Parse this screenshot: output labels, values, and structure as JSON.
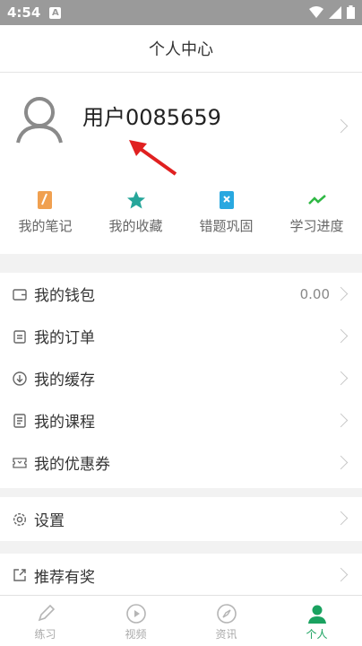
{
  "status_bar": {
    "time": "4:54",
    "notification_letter": "A"
  },
  "header": {
    "title": "个人中心"
  },
  "profile": {
    "username": "用户0085659"
  },
  "quick_actions": [
    {
      "label": "我的笔记",
      "icon": "note-icon",
      "color": "#f0a050"
    },
    {
      "label": "我的收藏",
      "icon": "star-icon",
      "color": "#26a69a"
    },
    {
      "label": "错题巩固",
      "icon": "wrong-question-icon",
      "color": "#29a8e0"
    },
    {
      "label": "学习进度",
      "icon": "progress-icon",
      "color": "#2fb844"
    }
  ],
  "menu1": [
    {
      "label": "我的钱包",
      "value": "0.00",
      "icon": "wallet-icon"
    },
    {
      "label": "我的订单",
      "icon": "order-icon"
    },
    {
      "label": "我的缓存",
      "icon": "download-icon"
    },
    {
      "label": "我的课程",
      "icon": "course-icon"
    },
    {
      "label": "我的优惠券",
      "icon": "coupon-icon"
    }
  ],
  "menu2": [
    {
      "label": "设置",
      "icon": "gear-icon"
    }
  ],
  "menu3": [
    {
      "label": "推荐有奖",
      "icon": "share-icon"
    }
  ],
  "tabs": [
    {
      "label": "练习",
      "icon": "pencil-icon"
    },
    {
      "label": "视频",
      "icon": "play-icon"
    },
    {
      "label": "资讯",
      "icon": "compass-icon"
    },
    {
      "label": "个人",
      "icon": "person-icon"
    }
  ],
  "colors": {
    "accent": "#1aa260",
    "annotation_arrow": "#e02020"
  }
}
